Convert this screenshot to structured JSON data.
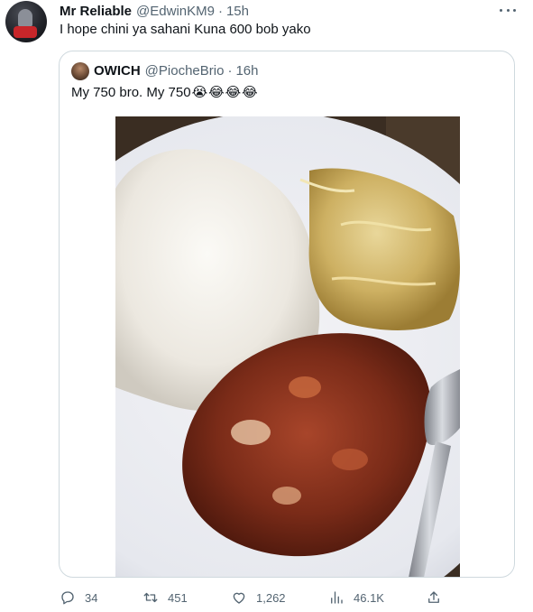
{
  "tweet": {
    "author_name": "Mr Reliable",
    "author_handle": "@EdwinKM9",
    "separator": "·",
    "time": "15h",
    "text": "I hope chini ya sahani Kuna 600 bob yako"
  },
  "quoted_tweet": {
    "author_name": "OWICH",
    "author_handle": "@PiocheBrio",
    "separator": "·",
    "time": "16h",
    "text": "My 750 bro. My 750",
    "emojis": [
      "😭",
      "😂",
      "😂",
      "😂"
    ]
  },
  "actions": {
    "reply_count": "34",
    "retweet_count": "451",
    "like_count": "1,262",
    "views_count": "46.1K"
  },
  "icons": {
    "more": "more-horizontal-icon",
    "reply": "reply-icon",
    "retweet": "retweet-icon",
    "like": "heart-icon",
    "views": "views-bar-chart-icon",
    "share": "share-icon"
  },
  "colors": {
    "text_primary": "#0f1419",
    "text_secondary": "#536471",
    "border": "#cfd9de"
  }
}
